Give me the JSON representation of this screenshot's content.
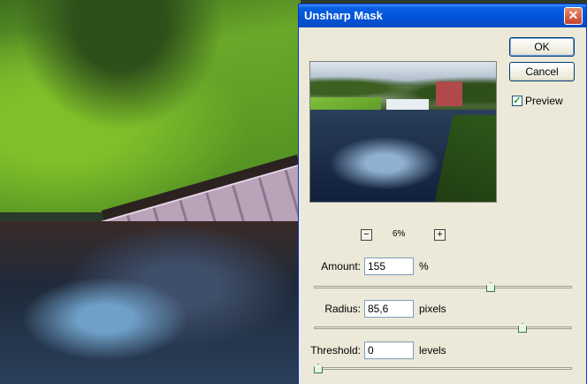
{
  "dialog": {
    "title": "Unsharp Mask",
    "close_symbol": "✕",
    "ok_label": "OK",
    "cancel_label": "Cancel",
    "preview_label": "Preview",
    "preview_checked": true,
    "zoom": "6%",
    "zoom_minus": "−",
    "zoom_plus": "+",
    "amount": {
      "label": "Amount:",
      "value": "155",
      "unit": "%",
      "slider_fraction": 0.69
    },
    "radius": {
      "label": "Radius:",
      "value": "85,6",
      "unit": "pixels",
      "slider_fraction": 0.82
    },
    "threshold": {
      "label": "Threshold:",
      "value": "0",
      "unit": "levels",
      "slider_fraction": 0.0
    }
  },
  "colors": {
    "titlebar": "#0052d6",
    "dialog_bg": "#ece9d8",
    "close_button": "#c4422a",
    "checkmark": "#21a121"
  },
  "icons": {
    "close": "close-icon",
    "check": "checkmark-icon",
    "zoom_out": "zoom-out-icon",
    "zoom_in": "zoom-in-icon"
  }
}
